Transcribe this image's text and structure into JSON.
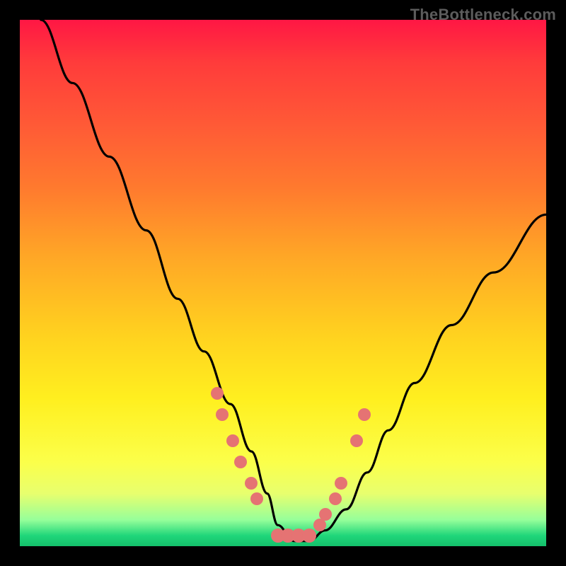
{
  "watermark": "TheBottleneck.com",
  "chart_data": {
    "type": "line",
    "title": "",
    "xlabel": "",
    "ylabel": "",
    "xlim": [
      0,
      100
    ],
    "ylim": [
      0,
      100
    ],
    "series": [
      {
        "name": "curve",
        "x": [
          4,
          10,
          17,
          24,
          30,
          35,
          40,
          44,
          47,
          49,
          52,
          55,
          58,
          62,
          66,
          70,
          75,
          82,
          90,
          100
        ],
        "y": [
          100,
          88,
          74,
          60,
          47,
          37,
          27,
          18,
          10,
          4,
          1,
          1,
          3,
          7,
          14,
          22,
          31,
          42,
          52,
          63
        ]
      }
    ],
    "markers": {
      "name": "highlight-points",
      "x": [
        37.5,
        38.5,
        40.5,
        42,
        44,
        45,
        49,
        51,
        53,
        55,
        57,
        58,
        60,
        61,
        64,
        65.5
      ],
      "y": [
        29,
        25,
        20,
        16,
        12,
        9,
        2,
        2,
        2,
        2,
        4,
        6,
        9,
        12,
        20,
        25
      ]
    },
    "background_gradient": {
      "stops": [
        {
          "pos": 0,
          "color": "#ff1744"
        },
        {
          "pos": 8,
          "color": "#ff3b3b"
        },
        {
          "pos": 20,
          "color": "#ff5a36"
        },
        {
          "pos": 32,
          "color": "#ff7a2e"
        },
        {
          "pos": 45,
          "color": "#ffa726"
        },
        {
          "pos": 60,
          "color": "#ffd21f"
        },
        {
          "pos": 72,
          "color": "#ffef1f"
        },
        {
          "pos": 84,
          "color": "#fbff4a"
        },
        {
          "pos": 90,
          "color": "#e8ff6e"
        },
        {
          "pos": 95,
          "color": "#96ff9a"
        },
        {
          "pos": 98,
          "color": "#1fd67a"
        },
        {
          "pos": 100,
          "color": "#14c06b"
        }
      ]
    }
  }
}
